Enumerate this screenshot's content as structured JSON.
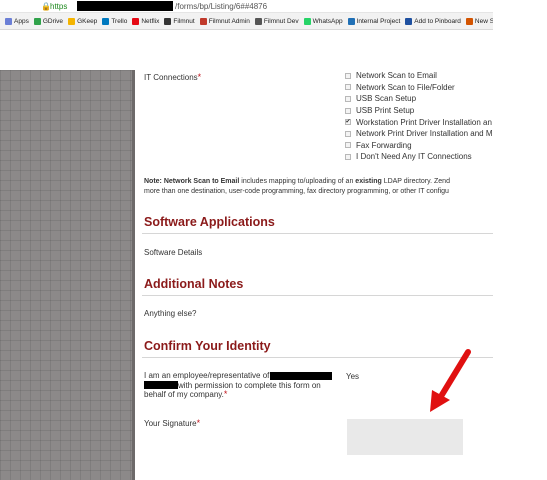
{
  "browser": {
    "url_scheme": "https",
    "url_path": "/forms/bp/Listing/6##4876",
    "bookmarks": [
      {
        "label": "Apps",
        "color": "#6b7fd6"
      },
      {
        "label": "GDrive",
        "color": "#2fa24a"
      },
      {
        "label": "GKeep",
        "color": "#f4b400"
      },
      {
        "label": "Trello",
        "color": "#0079bf"
      },
      {
        "label": "Netflix",
        "color": "#e50914"
      },
      {
        "label": "Filmnut",
        "color": "#333333"
      },
      {
        "label": "Filmnut Admin",
        "color": "#c0392b"
      },
      {
        "label": "Filmnut Dev",
        "color": "#555555"
      },
      {
        "label": "WhatsApp",
        "color": "#25d366"
      },
      {
        "label": "Internal Project",
        "color": "#1f6fb5"
      },
      {
        "label": "Add to Pinboard",
        "color": "#1e50a0"
      },
      {
        "label": "New Submission",
        "color": "#d35400"
      }
    ]
  },
  "form": {
    "it_connections_label": "IT Connections",
    "required_mark": "*",
    "it_options": [
      {
        "label": "Network Scan to Email",
        "checked": false
      },
      {
        "label": "Network Scan to File/Folder",
        "checked": false
      },
      {
        "label": "USB Scan Setup",
        "checked": false
      },
      {
        "label": "USB Print Setup",
        "checked": false
      },
      {
        "label": "Workstation Print Driver Installation an",
        "checked": true
      },
      {
        "label": "Network Print Driver Installation and M",
        "checked": false
      },
      {
        "label": "Fax Forwarding",
        "checked": false
      },
      {
        "label": "I Don't Need Any IT Connections",
        "checked": false
      }
    ],
    "note": {
      "prefix": "Note:",
      "bold_item": "Network Scan to Email",
      "text_1": " includes mapping to/uploading of an ",
      "bold_word": "existing",
      "text_2": " LDAP directory. Zend",
      "line_2": "more than one destination, user-code programming, fax directory programming, or other IT configu"
    },
    "software_heading": "Software Applications",
    "software_details_label": "Software Details",
    "notes_heading": "Additional Notes",
    "anything_else_label": "Anything else?",
    "identity_heading": "Confirm Your Identity",
    "employee_text_1": "I am an employee/representative of",
    "employee_text_2": "with permission to complete this form on",
    "employee_text_3": "behalf of my company.",
    "employee_answer": "Yes",
    "signature_label": "Your Signature"
  }
}
